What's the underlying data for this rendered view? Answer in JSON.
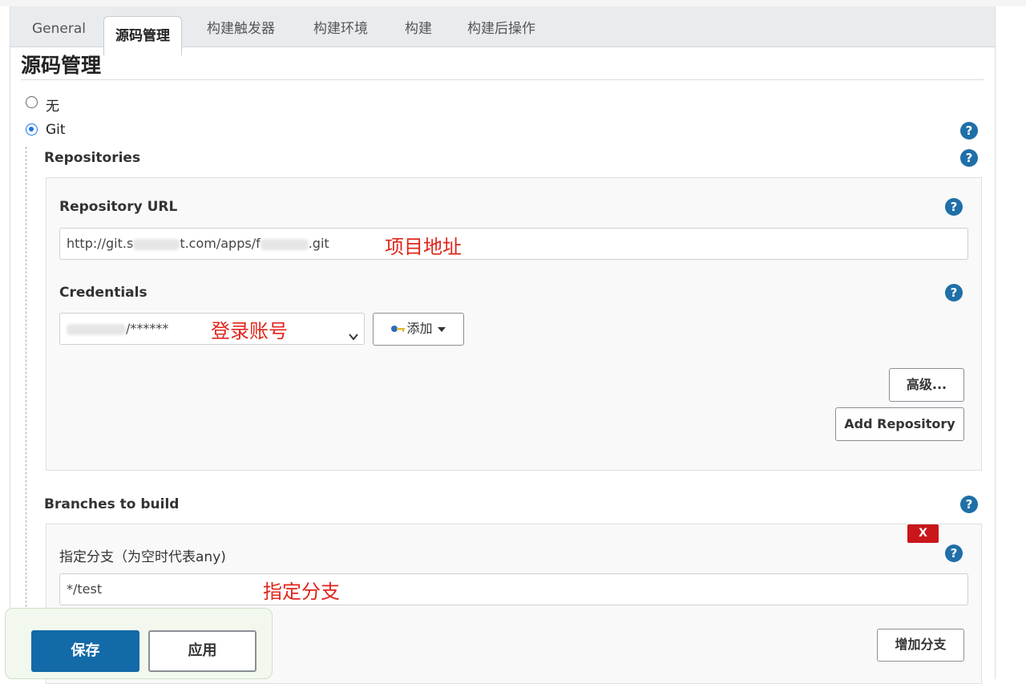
{
  "tabs": [
    {
      "label": "General"
    },
    {
      "label": "源码管理"
    },
    {
      "label": "构建触发器"
    },
    {
      "label": "构建环境"
    },
    {
      "label": "构建"
    },
    {
      "label": "构建后操作"
    }
  ],
  "section": {
    "title": "源码管理"
  },
  "scm": {
    "options": [
      {
        "label": "无",
        "checked": false
      },
      {
        "label": "Git",
        "checked": true
      }
    ],
    "help_glyph": "?"
  },
  "repositories": {
    "label": "Repositories",
    "url_label": "Repository URL",
    "url_parts": [
      "http://git.s",
      "t.com/apps/f",
      ".git"
    ],
    "url_annotation": "项目地址",
    "credentials_label": "Credentials",
    "credentials_value": "/******",
    "credentials_annotation": "登录账号",
    "add_button": "添加",
    "advanced_button": "高级...",
    "add_repository_button": "Add Repository"
  },
  "branches": {
    "label": "Branches to build",
    "branch_label": "指定分支（为空时代表any)",
    "branch_value": "*/test",
    "branch_annotation": "指定分支",
    "delete_button": "X",
    "add_branch_button": "增加分支"
  },
  "footer": {
    "save_button": "保存",
    "apply_button": "应用"
  },
  "colors": {
    "accent": "#136aa8",
    "help_icon": "#1f6fa8",
    "annotation": "#e0261b",
    "delete": "#c9161b"
  }
}
